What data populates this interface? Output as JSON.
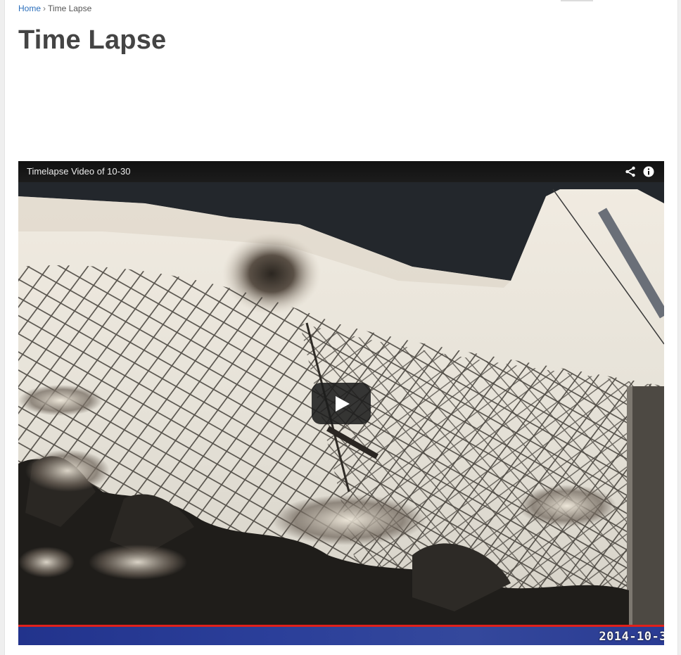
{
  "breadcrumb": {
    "home": "Home",
    "separator": "›",
    "current": "Time Lapse"
  },
  "page": {
    "title": "Time Lapse"
  },
  "player": {
    "video_title": "Timelapse Video of 10-30",
    "share_icon": "share-icon",
    "info_icon": "info-icon",
    "play_icon": "play-icon",
    "date_stamp": "2014-10-3",
    "progress": 1.0,
    "progress_color": "#e0201b"
  },
  "colors": {
    "link": "#2a6ebb",
    "title": "#444444",
    "player_bar": "#111111"
  }
}
